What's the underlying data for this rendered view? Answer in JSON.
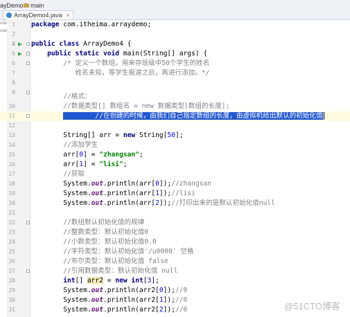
{
  "tabs": {
    "tab1": "ayDemo4",
    "tab2": "main",
    "active": "ArrayDemo4.java",
    "close_glyph": "×"
  },
  "left_clip": [
    "ode",
    "ode"
  ],
  "lines": [
    {
      "n": "1",
      "text": "package com.itheima.arraydemo;"
    },
    {
      "n": "2",
      "text": ""
    },
    {
      "n": "3",
      "text": ""
    },
    {
      "n": "4",
      "text": "public class ArrayDemo4 {"
    },
    {
      "n": "5",
      "text": "    public static void main(String[] args) {"
    },
    {
      "n": "6",
      "text": "        /* 定义一个数组，用来存班级中50个学生的姓名"
    },
    {
      "n": "7",
      "text": "           姓名未知，等学生报道之后，再进行添加。*/"
    },
    {
      "n": "8",
      "text": ""
    },
    {
      "n": "9",
      "text": ""
    },
    {
      "n": "9b",
      "text": "        //格式："
    },
    {
      "n": "10",
      "text": "        //数据类型[] 数组名 = new 数据类型[数组的长度];"
    },
    {
      "n": "11",
      "text": "        //在创建的时候，由我们自己指定数组的长度，由虚拟机给出默认的初始化值"
    },
    {
      "n": "12",
      "text": ""
    },
    {
      "n": "13",
      "text": "        String[] arr = new String[50];"
    },
    {
      "n": "14",
      "text": "        //添加学生"
    },
    {
      "n": "15",
      "text": "        arr[0] = \"zhangsan\";"
    },
    {
      "n": "16",
      "text": "        arr[1] = \"lisi\";"
    },
    {
      "n": "17",
      "text": "        //获取"
    },
    {
      "n": "18",
      "text": "        System.out.println(arr[0]);//zhangsan"
    },
    {
      "n": "19",
      "text": "        System.out.println(arr[1]);//lisi"
    },
    {
      "n": "20",
      "text": "        System.out.println(arr[2]);//打印出来的是默认初始化值null"
    },
    {
      "n": "21",
      "text": ""
    },
    {
      "n": "22",
      "text": "        //数组默认初始化值的规律"
    },
    {
      "n": "23",
      "text": "        //整数类型：默认初始化值0"
    },
    {
      "n": "24",
      "text": "        //小数类型：默认初始化值0.0"
    },
    {
      "n": "25",
      "text": "        //字符类型：默认初始化值'/u0000' 空格"
    },
    {
      "n": "26",
      "text": "        //布尔类型：默认初始化值 false"
    },
    {
      "n": "27",
      "text": "        //引用数据类型：默认初始化值 null"
    },
    {
      "n": "28",
      "text": "        int[] arr2 = new int[3];"
    },
    {
      "n": "29",
      "text": "        System.out.println(arr2[0]);//0"
    },
    {
      "n": "30",
      "text": "        System.out.println(arr2[1]);//0"
    },
    {
      "n": "31",
      "text": "        System.out.println(arr2[2]);//0"
    },
    {
      "n": "32",
      "text": "    }"
    },
    {
      "n": "33",
      "text": "}"
    }
  ],
  "watermark": "@51CTO博客",
  "colors": {
    "keyword": "#000080",
    "comment": "#808080",
    "string": "#008000",
    "number": "#0000ff",
    "selection": "#2157d0"
  }
}
